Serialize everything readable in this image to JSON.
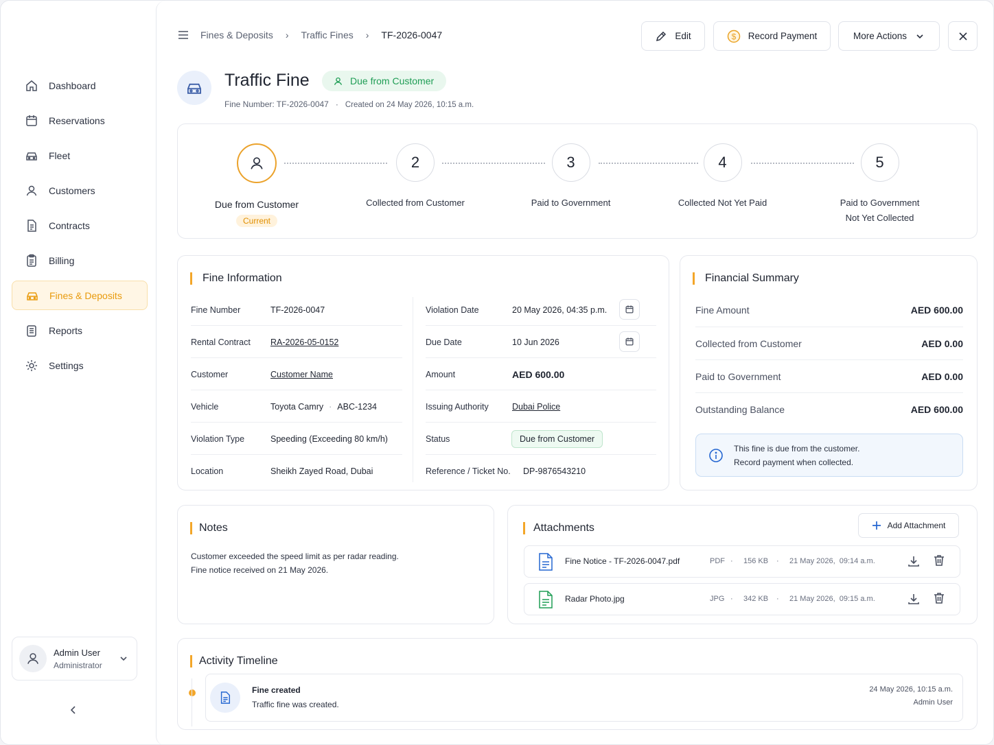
{
  "sidebar": {
    "items": [
      {
        "label": "Dashboard",
        "icon": "home-icon"
      },
      {
        "label": "Reservations",
        "icon": "calendar-icon"
      },
      {
        "label": "Fleet",
        "icon": "car-icon"
      },
      {
        "label": "Customers",
        "icon": "user-icon"
      },
      {
        "label": "Contracts",
        "icon": "document-icon"
      },
      {
        "label": "Billing",
        "icon": "clipboard-icon"
      },
      {
        "label": "Fines & Deposits",
        "icon": "car-icon"
      },
      {
        "label": "Reports",
        "icon": "report-icon"
      },
      {
        "label": "Settings",
        "icon": "gear-icon"
      }
    ],
    "active_item": "Fines & Deposits",
    "user": {
      "name": "Admin User",
      "role": "Administrator"
    }
  },
  "breadcrumb": [
    "Fines & Deposits",
    "Traffic Fines",
    "TF-2026-0047"
  ],
  "toolbar": {
    "edit": "Edit",
    "record_payment": "Record Payment",
    "more_actions": "More Actions"
  },
  "header": {
    "title": "Traffic Fine",
    "status": "Due from Customer",
    "fine_number": "Fine Number: TF-2026-0047",
    "created": "Created on 24 May 2026, 10:15 a.m."
  },
  "stepper": {
    "steps": [
      {
        "num": "",
        "label": "Due from Customer",
        "badge": "Current"
      },
      {
        "num": "2",
        "label": "Collected from Customer"
      },
      {
        "num": "3",
        "label": "Paid to Government"
      },
      {
        "num": "4",
        "label": "Collected Not Yet Paid"
      },
      {
        "num": "5",
        "label_line1": "Paid to Government",
        "label_line2": "Not Yet Collected"
      }
    ],
    "current_index": 0
  },
  "fine_info": {
    "title": "Fine Information",
    "left": [
      {
        "k": "Fine Number",
        "v": "TF-2026-0047"
      },
      {
        "k": "Rental Contract",
        "v": "RA-2026-05-0152"
      },
      {
        "k": "Customer",
        "v": "Customer Name"
      },
      {
        "k": "Vehicle",
        "v": "Toyota Camry",
        "v2": "ABC-1234"
      },
      {
        "k": "Violation Type",
        "v": "Speeding (Exceeding 80 km/h)"
      },
      {
        "k": "Location",
        "v": "Sheikh Zayed Road, Dubai"
      }
    ],
    "right": [
      {
        "k": "Violation Date",
        "v": "20 May 2026, 04:35 p.m."
      },
      {
        "k": "Due Date",
        "v": "10 Jun 2026"
      },
      {
        "k": "Amount",
        "v": "AED 600.00"
      },
      {
        "k": "Issuing Authority",
        "v": "Dubai Police"
      },
      {
        "k": "Status",
        "v": "Due from Customer"
      },
      {
        "k": "Reference / Ticket No.",
        "v": "DP-9876543210"
      }
    ]
  },
  "financial_summary": {
    "title": "Financial Summary",
    "rows": [
      {
        "k": "Fine Amount",
        "v": "AED 600.00"
      },
      {
        "k": "Collected from Customer",
        "v": "AED 0.00"
      },
      {
        "k": "Paid to Government",
        "v": "AED 0.00"
      },
      {
        "k": "Outstanding Balance",
        "v": "AED 600.00"
      }
    ],
    "info_line1": "This fine is due from the customer.",
    "info_line2": "Record payment when collected."
  },
  "notes": {
    "title": "Notes",
    "line1": "Customer exceeded the speed limit as per radar reading.",
    "line2": "Fine notice received on 21 May 2026."
  },
  "attachments": {
    "title": "Attachments",
    "add_label": "Add Attachment",
    "files": [
      {
        "name": "Fine Notice - TF-2026-0047.pdf",
        "type": "PDF",
        "size": "156 KB",
        "date": "21 May 2026,  09:14 a.m."
      },
      {
        "name": "Radar Photo.jpg",
        "type": "JPG",
        "size": "342 KB",
        "date": "21 May 2026,  09:15 a.m."
      }
    ]
  },
  "activity": {
    "title": "Activity Timeline",
    "items": [
      {
        "title": "Fine created",
        "desc": "Traffic fine was created.",
        "date": "24 May 2026, 10:15 a.m.",
        "by": "Admin User"
      }
    ]
  },
  "colors": {
    "accent": "#f3a629",
    "active_nav": "#e89a0c",
    "green": "#1f9d55",
    "red": "#e2262c",
    "link": "#2466d1"
  }
}
